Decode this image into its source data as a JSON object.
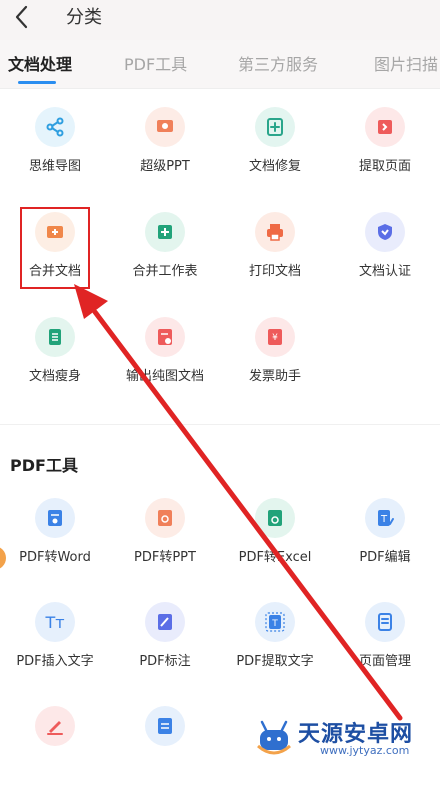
{
  "header": {
    "title": "分类"
  },
  "tabs": [
    {
      "label": "文档处理",
      "active": true
    },
    {
      "label": "PDF工具",
      "active": false
    },
    {
      "label": "第三方服务",
      "active": false
    },
    {
      "label": "图片扫描",
      "active": false
    }
  ],
  "doc_tools": [
    {
      "label": "思维导图",
      "icon": "mind-map-icon",
      "color": "#2f9fe0",
      "bg": "#e5f4fc"
    },
    {
      "label": "超级PPT",
      "icon": "ppt-icon",
      "color": "#f0805a",
      "bg": "#fdece6"
    },
    {
      "label": "文档修复",
      "icon": "doc-repair-icon",
      "color": "#2aa58b",
      "bg": "#e3f5f0"
    },
    {
      "label": "提取页面",
      "icon": "extract-page-icon",
      "color": "#ee5b5b",
      "bg": "#fde8e8"
    },
    {
      "label": "合并文档",
      "icon": "merge-doc-icon",
      "color": "#f0874a",
      "bg": "#fdeee4"
    },
    {
      "label": "合并工作表",
      "icon": "merge-sheet-icon",
      "color": "#22a37a",
      "bg": "#e3f5ee"
    },
    {
      "label": "打印文档",
      "icon": "print-icon",
      "color": "#ef6a45",
      "bg": "#fdebe4"
    },
    {
      "label": "文档认证",
      "icon": "certify-shield-icon",
      "color": "#5b6ee6",
      "bg": "#e9ecfc"
    },
    {
      "label": "文档瘦身",
      "icon": "slim-doc-icon",
      "color": "#22a37a",
      "bg": "#e3f5ee"
    },
    {
      "label": "输出纯图文档",
      "icon": "image-doc-icon",
      "color": "#ee5b5b",
      "bg": "#fde8e8"
    },
    {
      "label": "发票助手",
      "icon": "invoice-icon",
      "color": "#ee5b5b",
      "bg": "#fde8e8"
    }
  ],
  "pdf_section": {
    "title": "PDF工具"
  },
  "pdf_tools": [
    {
      "label": "PDF转Word",
      "icon": "pdf-to-word-icon",
      "color": "#3b82e6",
      "bg": "#e6f0fc"
    },
    {
      "label": "PDF转PPT",
      "icon": "pdf-to-ppt-icon",
      "color": "#f0805a",
      "bg": "#fdece6"
    },
    {
      "label": "PDF转Excel",
      "icon": "pdf-to-excel-icon",
      "color": "#22a37a",
      "bg": "#e3f5ee"
    },
    {
      "label": "PDF编辑",
      "icon": "pdf-edit-icon",
      "color": "#3b82e6",
      "bg": "#e6f0fc"
    },
    {
      "label": "PDF插入文字",
      "icon": "insert-text-icon",
      "color": "#3b82e6",
      "bg": "#e6f0fc"
    },
    {
      "label": "PDF标注",
      "icon": "annotate-icon",
      "color": "#5b6ee6",
      "bg": "#e9ecfc"
    },
    {
      "label": "PDF提取文字",
      "icon": "extract-text-icon",
      "color": "#3b82e6",
      "bg": "#e6f0fc"
    },
    {
      "label": "页面管理",
      "icon": "page-manage-icon",
      "color": "#3b82e6",
      "bg": "#e6f0fc"
    },
    {
      "label": "",
      "icon": "pdf-sign-icon",
      "color": "#ee5b5b",
      "bg": "#fde8e8"
    },
    {
      "label": "",
      "icon": "pdf-compress-icon",
      "color": "#3b82e6",
      "bg": "#e6f0fc"
    }
  ],
  "watermark": {
    "title": "天源安卓网",
    "url": "www.jytyaz.com"
  },
  "annotation_color": "#e02424"
}
